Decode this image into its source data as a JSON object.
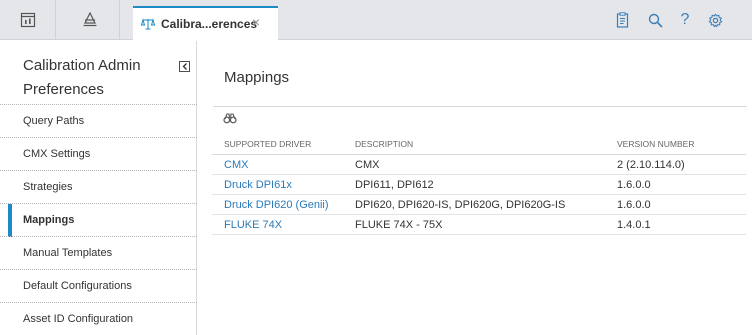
{
  "topbar": {
    "tab_title": "Calibra...erences",
    "tab_close": "×",
    "icons": [
      "dashboard-icon",
      "hierarchy-icon",
      "scales-icon",
      "close-icon",
      "clipboard-icon",
      "search-icon",
      "help-icon",
      "settings-icon"
    ],
    "help_glyph": "?"
  },
  "sidebar": {
    "title": "Calibration Admin Preferences",
    "items": [
      {
        "label": "Query Paths"
      },
      {
        "label": "CMX Settings"
      },
      {
        "label": "Strategies"
      },
      {
        "label": "Mappings",
        "active": true
      },
      {
        "label": "Manual Templates"
      },
      {
        "label": "Default Configurations"
      },
      {
        "label": "Asset ID Configuration"
      }
    ]
  },
  "main": {
    "title": "Mappings",
    "columns": [
      "SUPPORTED DRIVER",
      "DESCRIPTION",
      "VERSION NUMBER"
    ],
    "rows": [
      {
        "driver": "CMX",
        "description": "CMX",
        "version": "2 (2.10.114.0)"
      },
      {
        "driver": "Druck DPI61x",
        "description": "DPI611, DPI612",
        "version": "1.6.0.0"
      },
      {
        "driver": "Druck DPI620 (Genii)",
        "description": "DPI620, DPI620-IS, DPI620G, DPI620G-IS",
        "version": "1.6.0.0"
      },
      {
        "driver": "FLUKE 74X",
        "description": "FLUKE 74X - 75X",
        "version": "1.4.0.1"
      }
    ]
  },
  "colors": {
    "accent": "#1b8ac5",
    "link": "#2a7ab8",
    "topbar_bg": "#e4e6ea"
  }
}
